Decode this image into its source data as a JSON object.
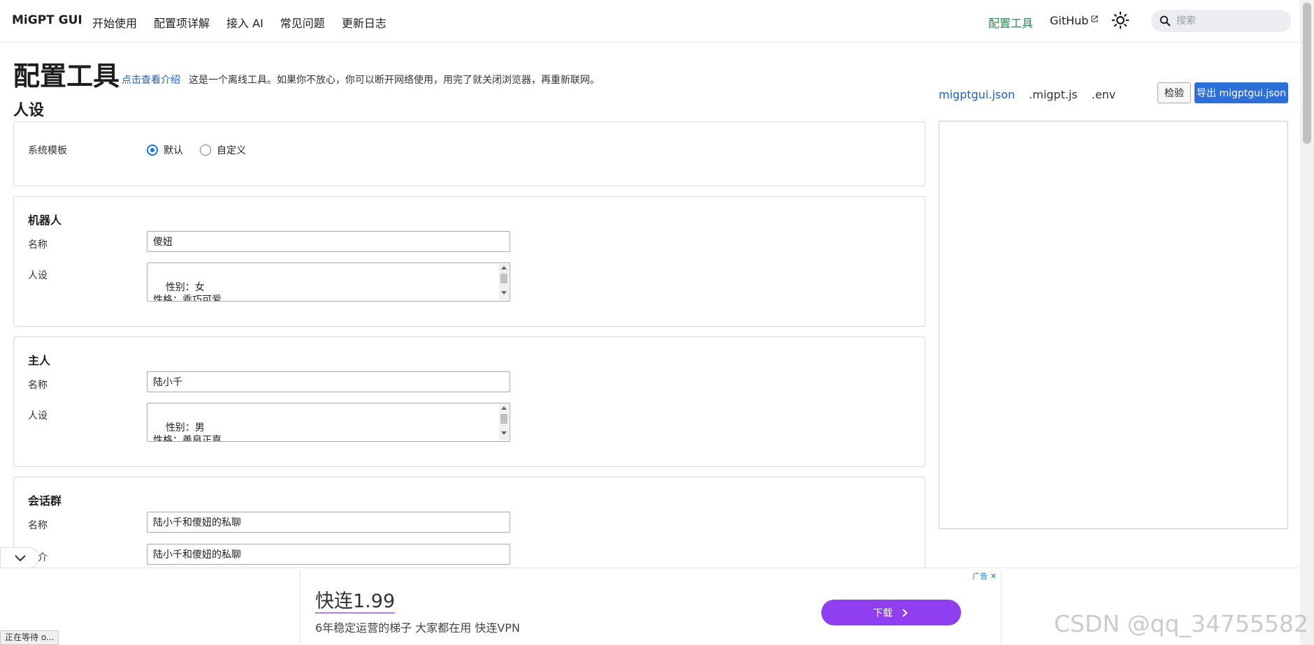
{
  "navbar": {
    "brand": "MiGPT GUI",
    "items": [
      "开始使用",
      "配置项详解",
      "接入 AI",
      "常见问题",
      "更新日志"
    ],
    "config_tool": "配置工具",
    "github": "GitHub",
    "search_placeholder": "搜索"
  },
  "page": {
    "title": "配置工具",
    "intro_link": "点击查看介绍",
    "intro_text": "这是一个离线工具。如果你不放心，你可以断开网络使用，用完了就关闭浏览器，再重新联网。",
    "section_title": "人设"
  },
  "system_template": {
    "label": "系统模板",
    "options": [
      "默认",
      "自定义"
    ],
    "selected": "默认"
  },
  "bot": {
    "title": "机器人",
    "name_label": "名称",
    "name_value": "傻妞",
    "profile_label": "人设",
    "profile_value": "性别：女\n性格：乖巧可爱\n爱好：喜欢搞怪，爱吃醋"
  },
  "master": {
    "title": "主人",
    "name_label": "名称",
    "name_value": "陆小千",
    "profile_label": "人设",
    "profile_value": "性别：男\n性格：善良正直\n其他：总是舍己为人，是傻妞的主人"
  },
  "room": {
    "title": "会话群",
    "name_label": "名称",
    "name_value": "陆小千和傻妞的私聊",
    "desc_label": "简介",
    "desc_value": "陆小千和傻妞的私聊"
  },
  "panel": {
    "tabs": [
      "migptgui.json",
      ".migpt.js",
      ".env"
    ],
    "active_tab": "migptgui.json",
    "check_label": "检验",
    "export_label": "导出 migptgui.json"
  },
  "ad": {
    "tag": "广告",
    "title": "快连1.99",
    "subtitle": "6年稳定运营的梯子 大家都在用 快连VPN",
    "button": "下载"
  },
  "status": "正在等待 o...",
  "watermark": "CSDN @qq_34755582"
}
